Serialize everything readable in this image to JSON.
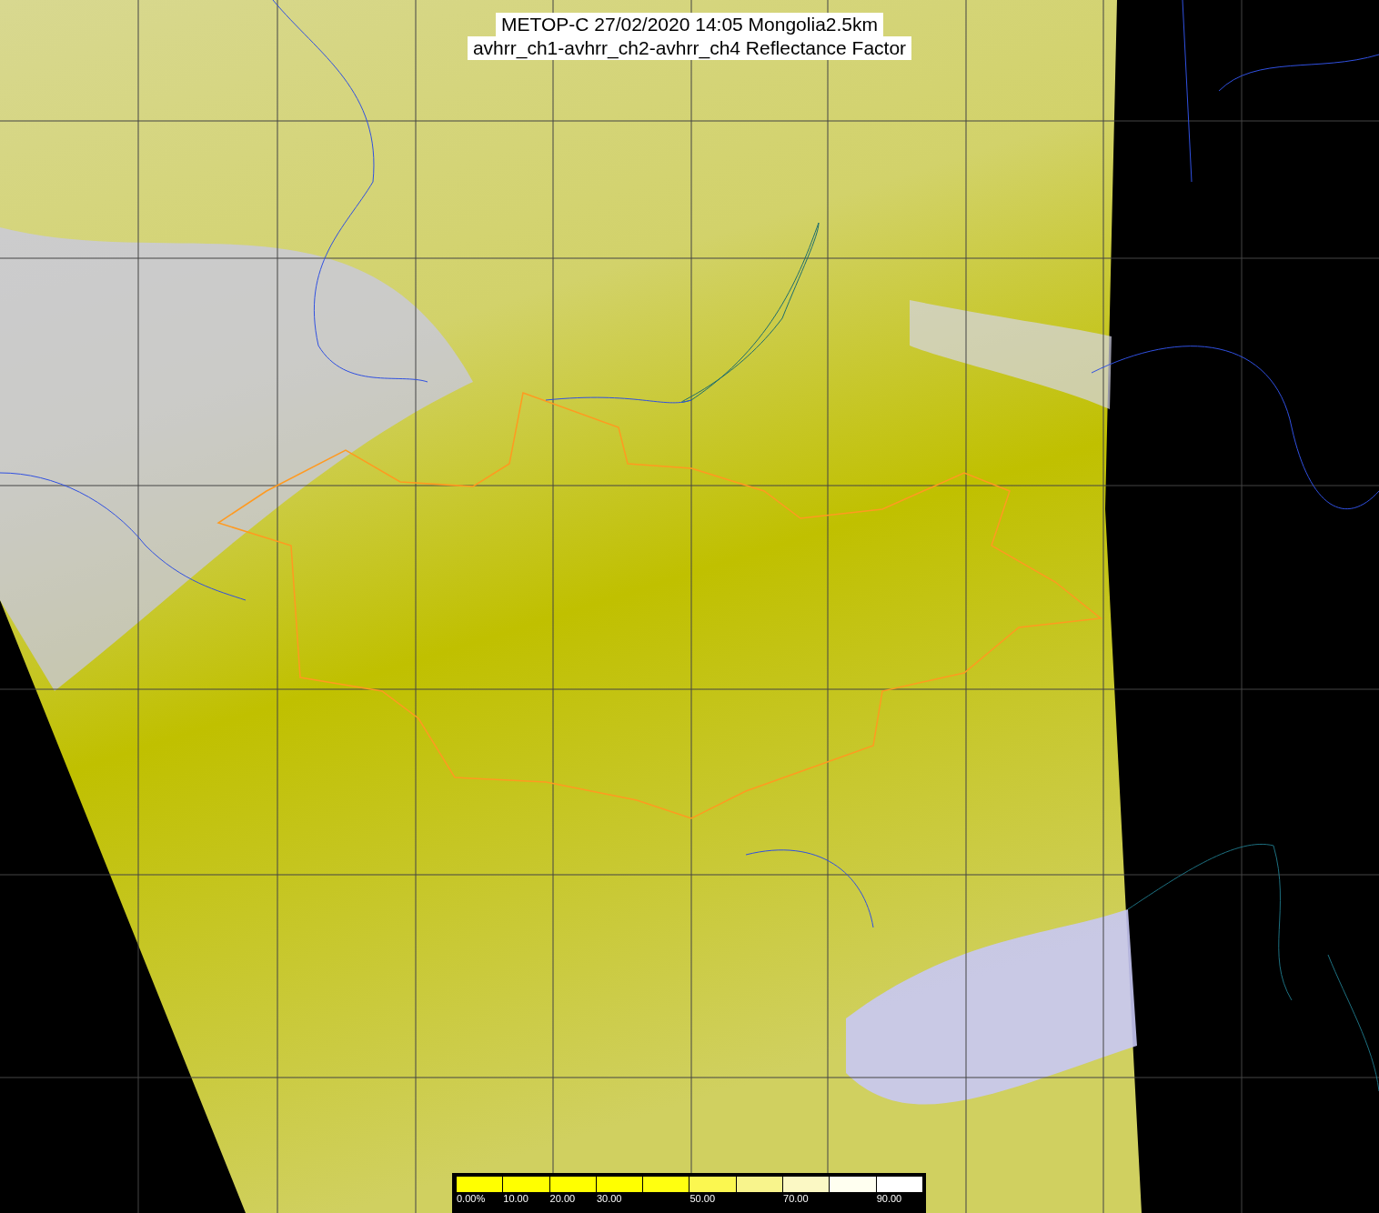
{
  "title": {
    "lines": [
      "METOP-C 27/02/2020 14:05 Mongolia2.5km",
      "avhrr_ch1-avhrr_ch2-avhrr_ch4 Reflectance Factor"
    ]
  },
  "colorbar": {
    "segments": [
      {
        "color": "#ffff00",
        "label": "0.00%"
      },
      {
        "color": "#ffff00",
        "label": "10.00"
      },
      {
        "color": "#ffff00",
        "label": "20.00"
      },
      {
        "color": "#ffff00",
        "label": "30.00"
      },
      {
        "color": "#ffff10"
      },
      {
        "color": "#fbf750",
        "label": "50.00"
      },
      {
        "color": "#f8f48c"
      },
      {
        "color": "#fbf8c4",
        "label": "70.00"
      },
      {
        "color": "#fffff0"
      },
      {
        "color": "#ffffff",
        "label": "90.00"
      }
    ]
  }
}
